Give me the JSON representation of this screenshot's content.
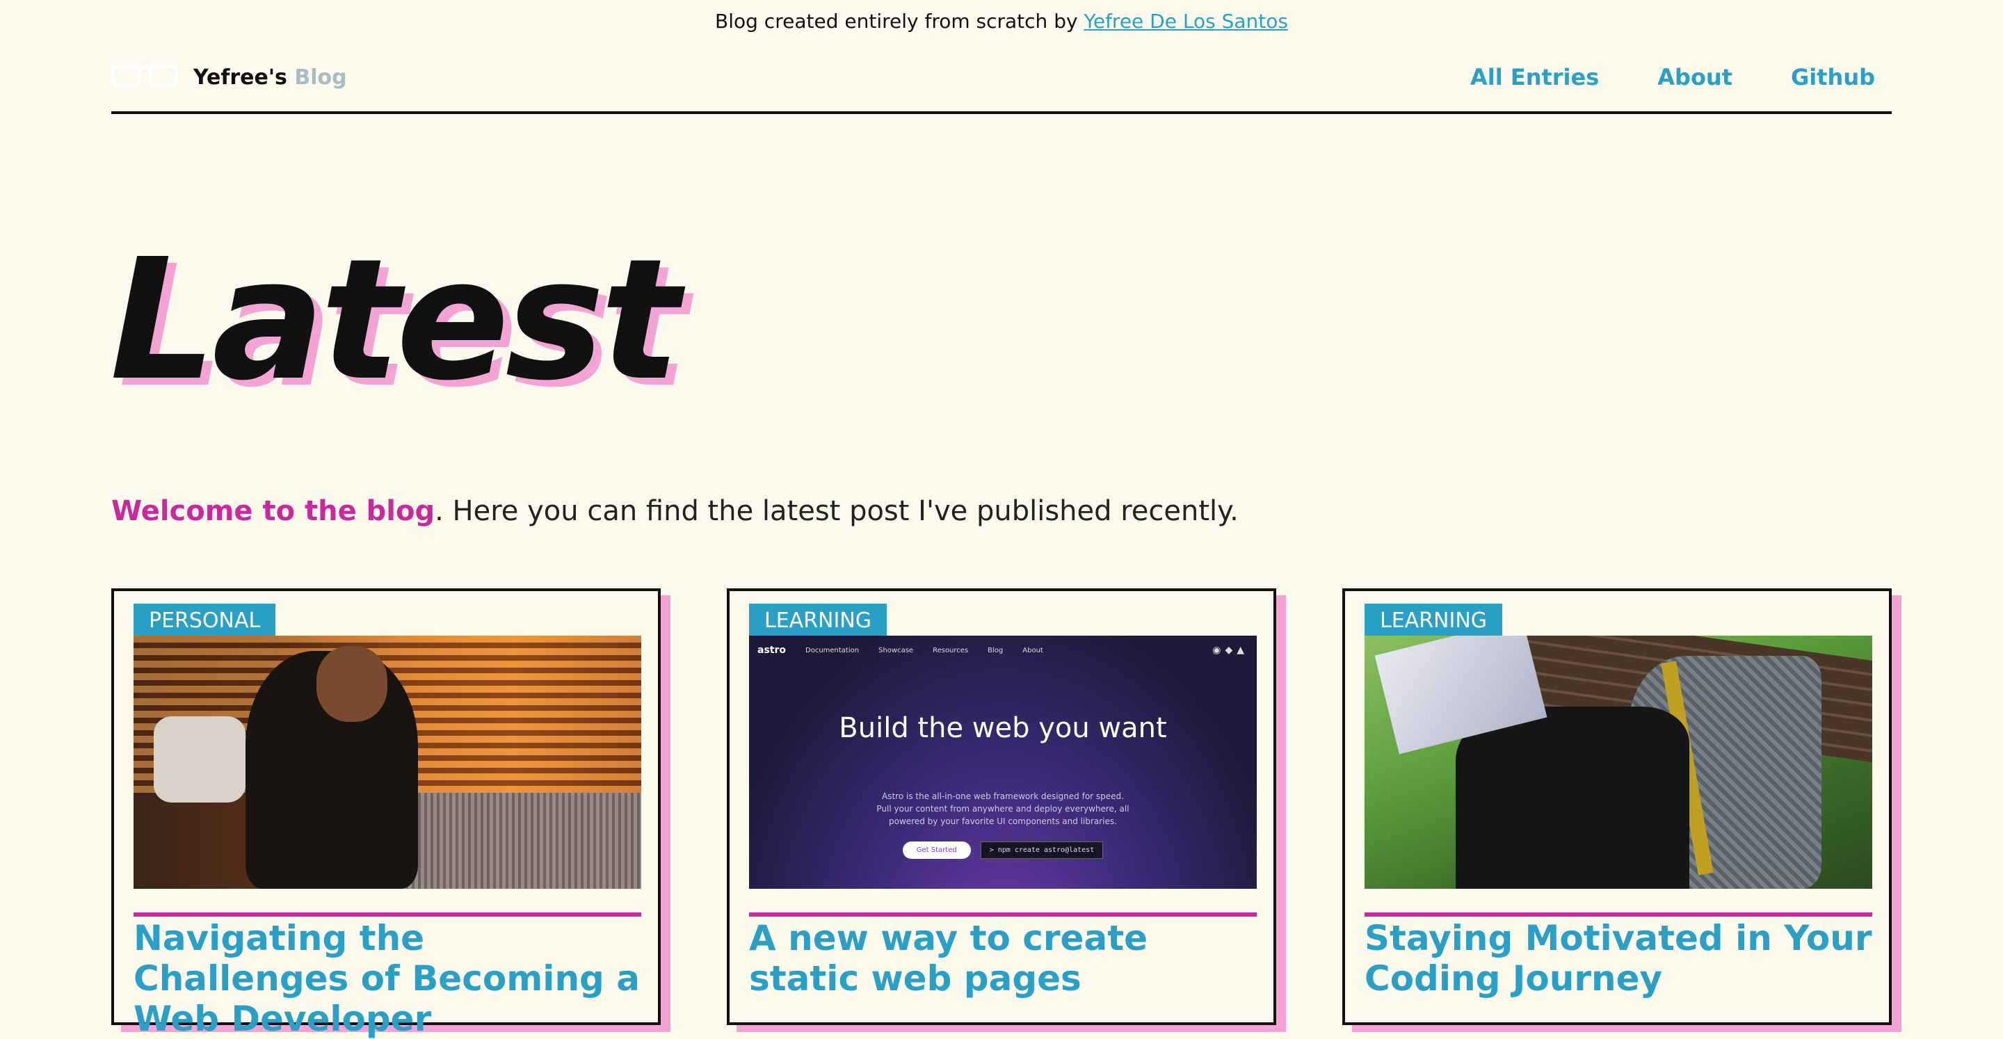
{
  "top_note": {
    "text": "Blog created entirely from scratch by ",
    "link_text": "Yefree De Los Santos"
  },
  "header": {
    "logo_name": "Yefree's",
    "logo_suffix": "Blog",
    "logo_icon": "glasses-icon",
    "nav": [
      {
        "label": "All Entries"
      },
      {
        "label": "About"
      },
      {
        "label": "Github"
      }
    ]
  },
  "hero": {
    "title": "Latest"
  },
  "intro": {
    "highlight": "Welcome to the blog",
    "text": ". Here you can find the latest post I've published recently."
  },
  "cards": [
    {
      "tag": "PERSONAL",
      "title": "Navigating the Challenges of Becoming a Web Developer"
    },
    {
      "tag": "LEARNING",
      "title": "A new way to create static web pages",
      "thumb": {
        "brand": "astro",
        "nav": [
          "Documentation",
          "Showcase",
          "Resources",
          "Blog",
          "About"
        ],
        "heading": "Build the web you want",
        "body": "Astro is the all-in-one web framework designed for speed. Pull your content from anywhere and deploy everywhere, all powered by your favorite UI components and libraries.",
        "primary_button": "Get Started",
        "command": "> npm create astro@latest"
      }
    },
    {
      "tag": "LEARNING",
      "title": "Staying Motivated in Your Coding Journey"
    }
  ],
  "colors": {
    "background": "#fcfaec",
    "accent_blue": "#2ba0c6",
    "accent_magenta": "#c82a9e",
    "shadow_pink": "#f4a4d4"
  }
}
